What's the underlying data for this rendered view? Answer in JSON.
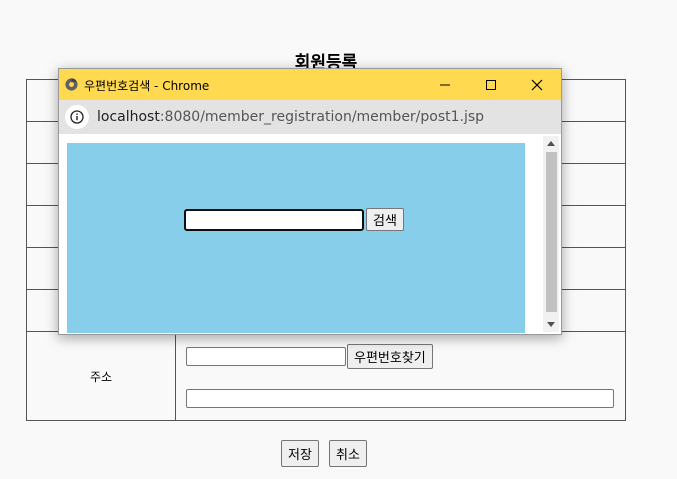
{
  "page": {
    "title": "회원등록",
    "address_label": "주소",
    "find_zip_label": "우편번호찾기",
    "save_label": "저장",
    "cancel_label": "취소"
  },
  "popup": {
    "window_title": "우편번호검색 - Chrome",
    "url_host": "localhost",
    "url_rest": ":8080/member_registration/member/post1.jsp",
    "search_button_label": "검색",
    "search_value": "",
    "panel_color": "#87ceeb",
    "titlebar_color": "#ffd94f"
  },
  "icons": [
    "chrome-icon",
    "minimize-icon",
    "maximize-icon",
    "close-icon",
    "info-icon",
    "scroll-up-icon",
    "scroll-down-icon"
  ]
}
